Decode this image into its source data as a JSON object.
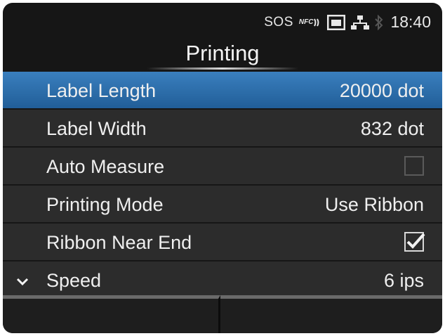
{
  "status": {
    "sos": "SOS",
    "nfc": "NFC",
    "time": "18:40",
    "icons": [
      "nfc-icon",
      "sd-card-icon",
      "network-icon",
      "bluetooth-icon"
    ]
  },
  "header": {
    "title": "Printing"
  },
  "items": [
    {
      "label": "Label Length",
      "value": "20000 dot",
      "selected": true
    },
    {
      "label": "Label Width",
      "value": "832 dot"
    },
    {
      "label": "Auto Measure",
      "type": "checkbox",
      "checked": false
    },
    {
      "label": "Printing Mode",
      "value": "Use Ribbon"
    },
    {
      "label": "Ribbon Near End",
      "type": "checkbox",
      "checked": true
    },
    {
      "label": "Speed",
      "value": "6 ips",
      "icon": "chevron-down-icon"
    }
  ],
  "softkeys": {
    "left_label": "",
    "right_label": ""
  },
  "colors": {
    "selected_row": "#2f72b4",
    "row_bg": "#2c2c2c",
    "screen_bg": "#161616"
  }
}
